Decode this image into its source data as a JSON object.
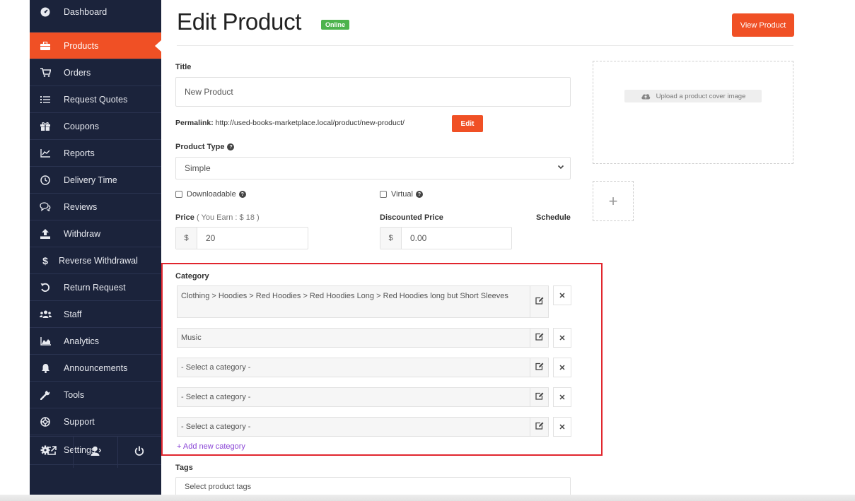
{
  "sidebar": {
    "items": [
      {
        "label": "Dashboard",
        "icon": "dashboard-icon"
      },
      {
        "label": "Products",
        "icon": "briefcase-icon"
      },
      {
        "label": "Orders",
        "icon": "cart-icon"
      },
      {
        "label": "Request Quotes",
        "icon": "list-icon"
      },
      {
        "label": "Coupons",
        "icon": "gift-icon"
      },
      {
        "label": "Reports",
        "icon": "chart-line-icon"
      },
      {
        "label": "Delivery Time",
        "icon": "clock-icon"
      },
      {
        "label": "Reviews",
        "icon": "comments-icon"
      },
      {
        "label": "Withdraw",
        "icon": "upload-icon"
      },
      {
        "label": "Reverse Withdrawal",
        "icon": "dollar-icon"
      },
      {
        "label": "Return Request",
        "icon": "undo-icon"
      },
      {
        "label": "Staff",
        "icon": "users-icon"
      },
      {
        "label": "Analytics",
        "icon": "area-chart-icon"
      },
      {
        "label": "Announcements",
        "icon": "bell-icon"
      },
      {
        "label": "Tools",
        "icon": "wrench-icon"
      },
      {
        "label": "Support",
        "icon": "lifebuoy-icon"
      },
      {
        "label": "Settings",
        "icon": "gear-icon",
        "suffix": "›"
      }
    ],
    "active_index": 1,
    "bottom_icons": [
      "external-link-icon",
      "user-icon",
      "power-icon"
    ]
  },
  "header": {
    "title": "Edit Product",
    "status_badge": "Online",
    "view_button": "View Product"
  },
  "form": {
    "title_label": "Title",
    "title_value": "New Product",
    "permalink_label": "Permalink:",
    "permalink_url": "http://used-books-marketplace.local/product/new-product/",
    "permalink_edit": "Edit",
    "product_type_label": "Product Type",
    "product_type_value": "Simple",
    "downloadable_label": "Downloadable",
    "virtual_label": "Virtual",
    "price_label": "Price",
    "price_note": "( You Earn : $ 18 )",
    "price_currency": "$",
    "price_value": "20",
    "discounted_label": "Discounted Price",
    "discounted_currency": "$",
    "discounted_value": "0.00",
    "schedule_label": "Schedule",
    "tags_label": "Tags",
    "tags_placeholder": "Select product tags"
  },
  "category": {
    "label": "Category",
    "rows": [
      "Clothing > Hoodies > Red Hoodies > Red Hoodies Long > Red Hoodies long but Short Sleeves",
      "Music",
      "- Select a category -",
      "- Select a category -",
      "- Select a category -"
    ],
    "add_link": "+ Add new category"
  },
  "upload": {
    "cover_button": "Upload a product cover image",
    "gallery_add": "+"
  },
  "colors": {
    "sidebar_bg": "#1b233b",
    "accent": "#f05025",
    "online_badge": "#4cb34c",
    "highlight_border": "#e1262e",
    "link_purple": "#8a45d6"
  }
}
